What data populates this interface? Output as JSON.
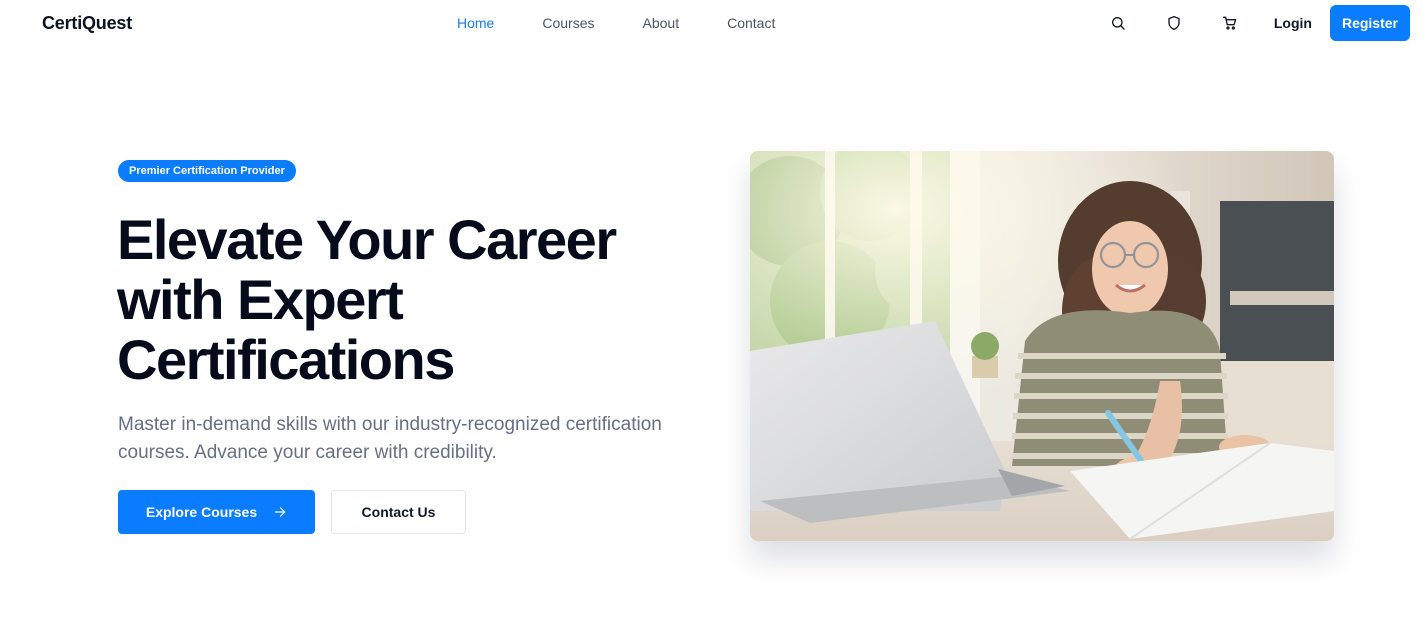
{
  "brand": {
    "name": "CertiQuest"
  },
  "nav": {
    "links": [
      {
        "label": "Home",
        "active": true
      },
      {
        "label": "Courses",
        "active": false
      },
      {
        "label": "About",
        "active": false
      },
      {
        "label": "Contact",
        "active": false
      }
    ],
    "icons": [
      "search-icon",
      "shield-icon",
      "cart-icon"
    ],
    "login_label": "Login",
    "register_label": "Register"
  },
  "hero": {
    "badge": "Premier Certification Provider",
    "headline": "Elevate Your Career with Expert Certifications",
    "subtext": "Master in-demand skills with our industry-recognized certification courses. Advance your career with credibility.",
    "primary_button": "Explore Courses",
    "secondary_button": "Contact Us"
  },
  "colors": {
    "accent": "#0a7cff",
    "nav_active": "#1f7ae0",
    "headline": "#050b1a",
    "muted_text": "#667085"
  }
}
